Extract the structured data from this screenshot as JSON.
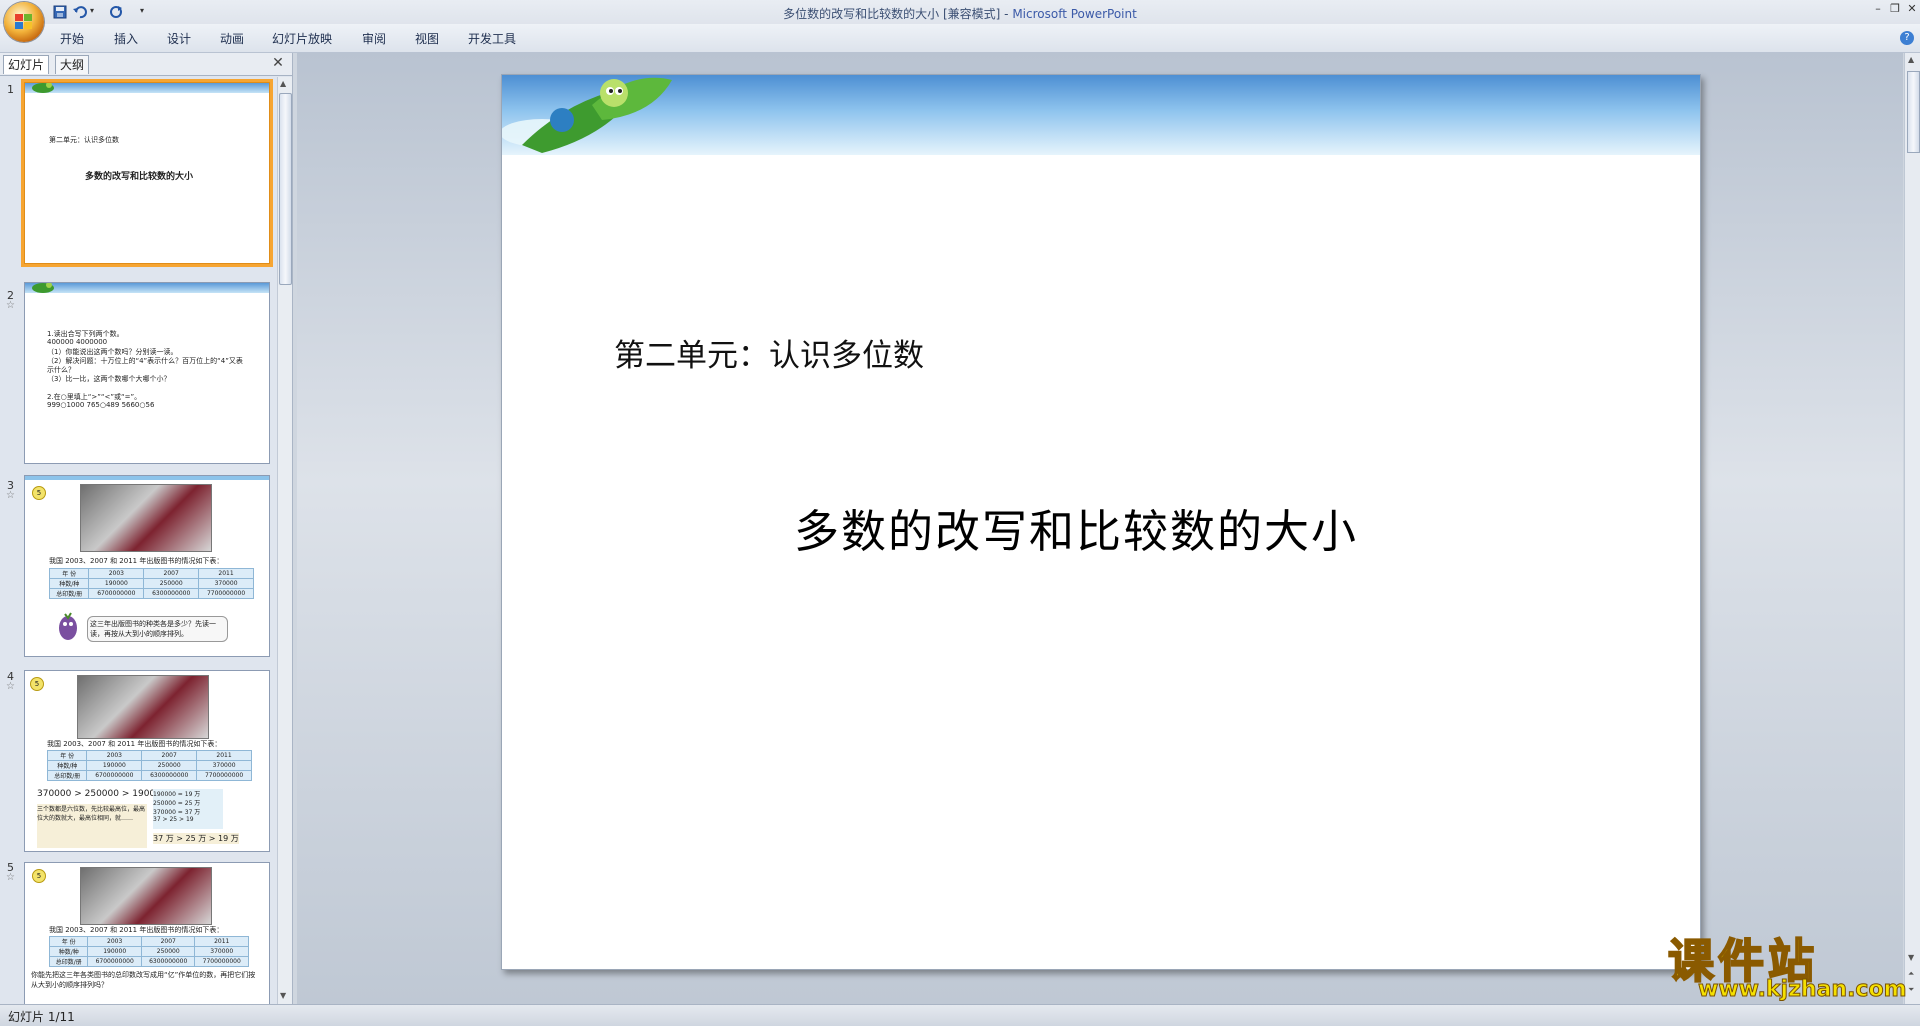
{
  "window": {
    "title": "多位数的改写和比较数的大小 [兼容模式] - ",
    "app_name": "Microsoft PowerPoint"
  },
  "ribbon": {
    "tabs": [
      "开始",
      "插入",
      "设计",
      "动画",
      "幻灯片放映",
      "审阅",
      "视图",
      "开发工具"
    ]
  },
  "left_pane": {
    "tab_slides": "幻灯片",
    "tab_outline": "大纲",
    "thumbnails": [
      {
        "number": "1",
        "line1": "第二单元：认识多位数",
        "line2": "多数的改写和比较数的大小"
      },
      {
        "number": "2",
        "lines": [
          "1.读出合写下列两个数。",
          "400000   4000000",
          "（1）你能说出这两个数吗？分别读一读。",
          "（2）解决问题：十万位上的“4”表示什么？百万位上的“4”又表",
          "示什么？",
          "（3）比一比，这两个数哪个大哪个小？",
          "",
          "2.在○里填上“>”“<”或“=”。",
          "999○1000   765○489   5660○56"
        ]
      },
      {
        "number": "3",
        "caption": "我国 2003、2007 和 2011 年出版图书的情况如下表：",
        "table": [
          [
            "年 份",
            "2003",
            "2007",
            "2011"
          ],
          [
            "种数/种",
            "190000",
            "250000",
            "370000"
          ],
          [
            "总印数/册",
            "6700000000",
            "6300000000",
            "7700000000"
          ]
        ],
        "bubble": "这三年出版图书的种类各是多少？先读一读，再按从大到小的顺序排列。"
      },
      {
        "number": "4",
        "caption": "我国 2003、2007 和 2011 年出版图书的情况如下表：",
        "table": [
          [
            "年 份",
            "2003",
            "2007",
            "2011"
          ],
          [
            "种数/种",
            "190000",
            "250000",
            "370000"
          ],
          [
            "总印数/册",
            "6700000000",
            "6300000000",
            "7700000000"
          ]
        ],
        "compare": "370000 > 250000 > 190000",
        "note": "三个数都是六位数，先比较最高位，最高位大的数就大，最高位相同，就……",
        "box": [
          "190000 = 19 万",
          "250000 = 25 万",
          "370000 = 37 万",
          "37 > 25 > 19"
        ],
        "result": "37 万 > 25 万 > 19 万"
      },
      {
        "number": "5",
        "caption": "我国 2003、2007 和 2011 年出版图书的情况如下表：",
        "table": [
          [
            "年 份",
            "2003",
            "2007",
            "2011"
          ],
          [
            "种数/种",
            "190000",
            "250000",
            "370000"
          ],
          [
            "总印数/册",
            "6700000000",
            "6300000000",
            "7700000000"
          ]
        ],
        "question": "你能先把这三年各类图书的总印数改写成用“亿”作单位的数，再把它们按从大到小的顺序排列吗？"
      }
    ]
  },
  "slide": {
    "subtitle": "第二单元：认识多位数",
    "title": "多数的改写和比较数的大小"
  },
  "status": {
    "text": "幻灯片 1/11"
  },
  "watermark": {
    "cn": "课件站",
    "url": "www.kjzhan.com"
  },
  "colors": {
    "selection": "#f6a532",
    "sky": "#4d8fd3",
    "watermark": "#f5e000"
  }
}
